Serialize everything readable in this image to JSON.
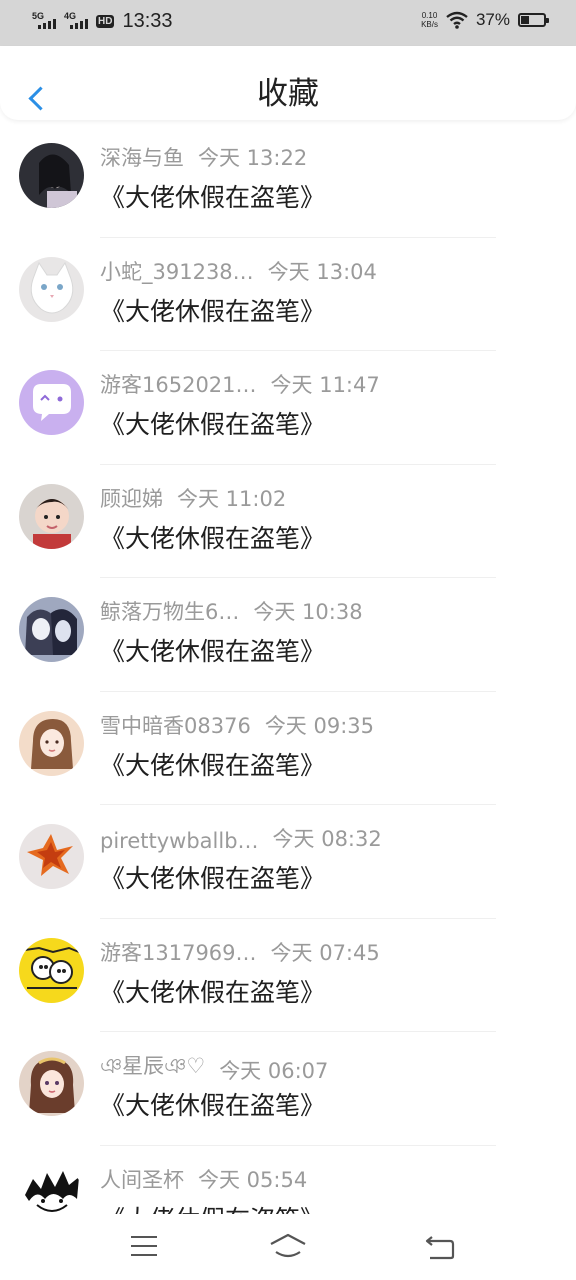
{
  "status": {
    "net1": "5G",
    "net2": "4G",
    "hd": "HD",
    "time": "13:33",
    "speed_value": "0.10",
    "speed_unit": "KB/s",
    "battery": "37%",
    "battery_level": 0.37
  },
  "header": {
    "title": "收藏"
  },
  "items": [
    {
      "name": "深海与鱼",
      "time": "今天  13:22",
      "book": "《大佬休假在盗笔》",
      "avatar": "avatar-girl-dark-icon"
    },
    {
      "name": "小蛇_391238…",
      "time": "今天  13:04",
      "book": "《大佬休假在盗笔》",
      "avatar": "avatar-white-cat-icon"
    },
    {
      "name": "游客1652021…",
      "time": "今天  11:47",
      "book": "《大佬休假在盗笔》",
      "avatar": "avatar-chat-bubble-icon"
    },
    {
      "name": "顾迎娣",
      "time": "今天  11:02",
      "book": "《大佬休假在盗笔》",
      "avatar": "avatar-baby-icon"
    },
    {
      "name": "鲸落万物生6…",
      "time": "今天  10:38",
      "book": "《大佬休假在盗笔》",
      "avatar": "avatar-anime-couple-icon"
    },
    {
      "name": "雪中暗香08376",
      "time": "今天  09:35",
      "book": "《大佬休假在盗笔》",
      "avatar": "avatar-girl-light-icon"
    },
    {
      "name": "pirettywballb…",
      "time": "今天  08:32",
      "book": "《大佬休假在盗笔》",
      "avatar": "avatar-orange-flower-icon"
    },
    {
      "name": "游客1317969…",
      "time": "今天  07:45",
      "book": "《大佬休假在盗笔》",
      "avatar": "avatar-yellow-cartoon-icon"
    },
    {
      "name": "ঞ星辰ঞ♡",
      "time": "今天  06:07",
      "book": "《大佬休假在盗笔》",
      "avatar": "avatar-anime-girl-icon"
    },
    {
      "name": "人间圣杯",
      "time": "今天  05:54",
      "book": "《大佬休假在盗笔》",
      "avatar": "avatar-sketch-icon"
    }
  ],
  "colors": {
    "accent": "#2b8fe6",
    "muted_text": "#9a9a9a",
    "status_bar": "#d6d6d6"
  }
}
